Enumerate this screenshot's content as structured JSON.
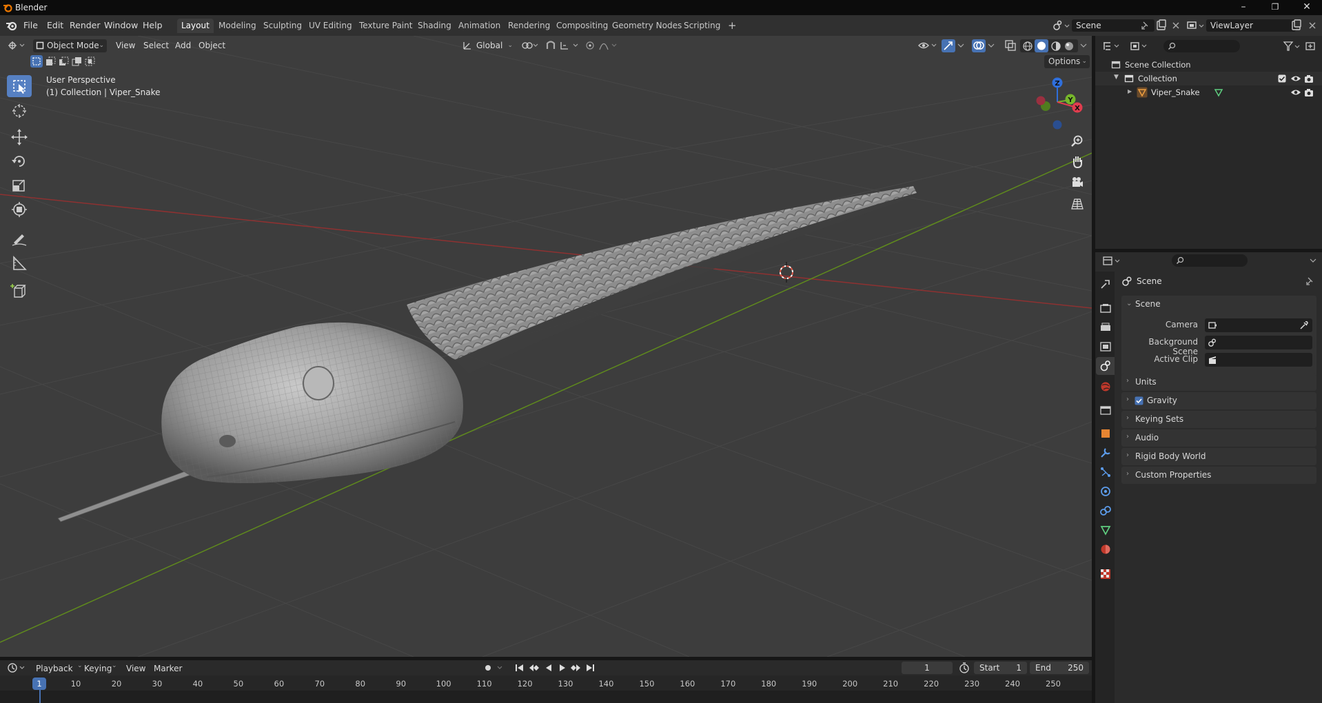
{
  "window": {
    "title": "Blender"
  },
  "menu": [
    "File",
    "Edit",
    "Render",
    "Window",
    "Help"
  ],
  "workspaces": [
    "Layout",
    "Modeling",
    "Sculpting",
    "UV Editing",
    "Texture Paint",
    "Shading",
    "Animation",
    "Rendering",
    "Compositing",
    "Geometry Nodes",
    "Scripting"
  ],
  "active_workspace": "Layout",
  "scene_field": "Scene",
  "viewlayer_field": "ViewLayer",
  "viewport": {
    "mode": "Object Mode",
    "menus": [
      "View",
      "Select",
      "Add",
      "Object"
    ],
    "orientation": "Global",
    "options": "Options",
    "info_line1": "User Perspective",
    "info_line2": "(1) Collection | Viper_Snake",
    "gizmo": {
      "z": "Z",
      "y": "Y",
      "x": "X"
    }
  },
  "outliner": {
    "root": "Scene Collection",
    "collection": "Collection",
    "object": "Viper_Snake"
  },
  "properties": {
    "header": "Scene",
    "panel_scene": "Scene",
    "camera_label": "Camera",
    "background_label": "Background Scene",
    "clip_label": "Active Clip",
    "panels": [
      "Units",
      "Gravity",
      "Keying Sets",
      "Audio",
      "Rigid Body World",
      "Custom Properties"
    ],
    "gravity_checked": true
  },
  "timeline": {
    "menus": [
      "Playback",
      "Keying",
      "View",
      "Marker"
    ],
    "current_frame": "1",
    "start_label": "Start",
    "start_value": "1",
    "end_label": "End",
    "end_value": "250",
    "ticks": [
      "1",
      "10",
      "20",
      "30",
      "40",
      "50",
      "60",
      "70",
      "80",
      "90",
      "100",
      "110",
      "120",
      "130",
      "140",
      "150",
      "160",
      "170",
      "180",
      "190",
      "200",
      "210",
      "220",
      "230",
      "240",
      "250"
    ]
  },
  "colors": {
    "accent": "#4772b3",
    "x_axis": "#b93b3b",
    "y_axis": "#6c9a1e",
    "active_tool": "#5680c2"
  }
}
